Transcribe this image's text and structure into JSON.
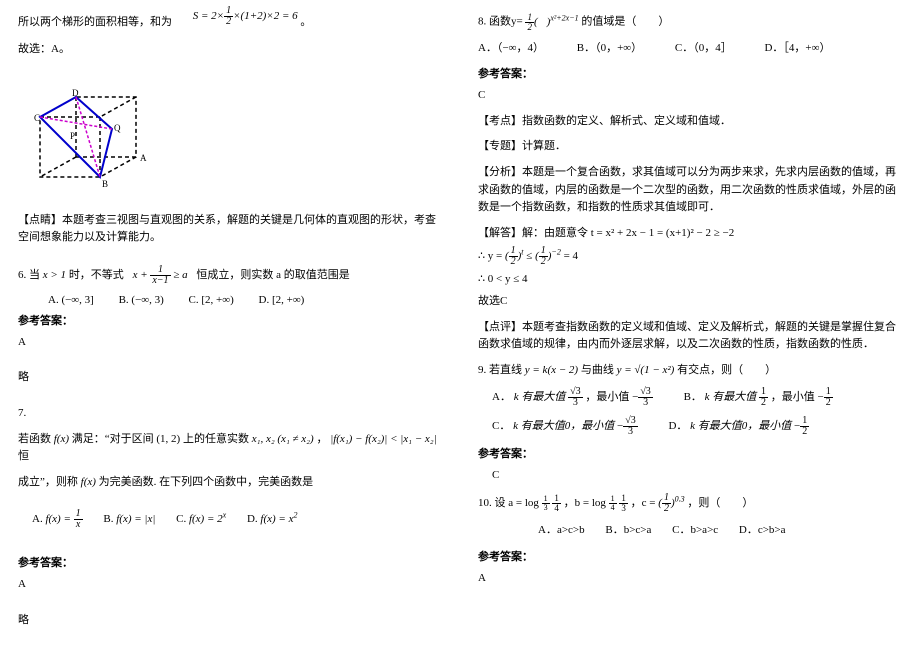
{
  "left": {
    "area_text": "所以两个梯形的面积相等，和为",
    "area_formula": "S = 2×(1/2)×(1+2)×2 = 6",
    "area_suffix": "。",
    "choice": "故选：A。",
    "dianjing": "【点睛】本题考查三视图与直观图的关系，解题的关键是几何体的直观图的形状，考查空间想象能力以及计算能力。",
    "q6_a": "6. 当",
    "q6_b": "x > 1",
    "q6_c": "时，不等式",
    "q6_formula": "x + 1/(x−1) ≥ a",
    "q6_d": "恒成立，则实数 a 的取值范围是",
    "q6_opts": {
      "a": "A. (−∞, 3]",
      "b": "B. (−∞, 3)",
      "c": "C. [2, +∞)",
      "d": "D. [2, +∞)"
    },
    "ans6_hdr": "参考答案：",
    "ans6": "A",
    "ans6_note": "略",
    "q7_num": "7.",
    "q7_a": "若函数",
    "q7_fx": "f(x)",
    "q7_b": "满足：“对于区间 (1, 2) 上的任意实数",
    "q7_c": "x₁, x₂ (x₁ ≠ x₂)，",
    "q7_d": "|f(x₁) − f(x₂)| < |x₁ − x₂|",
    "q7_e": " 恒",
    "q7_f": "成立”，则称",
    "q7_g": "为完美函数. 在下列四个函数中，完美函数是",
    "q7_opts": {
      "a_l": "A.",
      "a_f": "f(x) = 1/x",
      "b_l": "B.",
      "b_f": "f(x) = |x|",
      "c_l": "C.",
      "c_f": "f(x) = 2ˣ",
      "d_l": "D.",
      "d_f": "f(x) = x²"
    },
    "ans7_hdr": "参考答案：",
    "ans7": "A",
    "ans7_note": "略"
  },
  "right": {
    "q8_a": "8. 函数y=",
    "q8_base": "(1/2)",
    "q8_exp": "x²+2x−1",
    "q8_b": "的值域是（　　）",
    "q8_opts": {
      "a": "A．（−∞，4）",
      "b": "B．（0，+∞）",
      "c": "C．（0，4］",
      "d": "D．［4，+∞）"
    },
    "ans8_hdr": "参考答案：",
    "ans8": "C",
    "kaodian": "【考点】指数函数的定义、解析式、定义域和值域．",
    "zhuanti": "【专题】计算题．",
    "fenxi": "【分析】本题是一个复合函数，求其值域可以分为两步来求，先求内层函数的值域，再求函数的值域，内层的函数是一个二次型的函数，用二次函数的性质求值域，外层的函数是一个指数函数，和指数的性质求其值域即可．",
    "jieda_a": "【解答】解：由题意令 t = x² + 2x − 1 = (x+1)² − 2 ≥ −2",
    "jieda_b_pre": "∴ y =",
    "jieda_b_mid": " ≤ ",
    "jieda_b_exp2": "−2",
    "jieda_b_suf": " = 4",
    "jieda_c": "∴ 0 < y ≤ 4",
    "jieda_d": "故选C",
    "dianping": "【点评】本题考查指数函数的定义域和值域、定义及解析式，解题的关键是掌握住复合函数求值域的规律，由内而外逐层求解，以及二次函数的性质，指数函数的性质．",
    "q9_a": "9. 若直线",
    "q9_fy": "y = k(x − 2)",
    "q9_b": "与曲线",
    "q9_fc": "y = √(1 − x²)",
    "q9_c": "有交点，则（　　）",
    "q9_opts": {
      "a_l": "A．",
      "a_t": "k 有最大值",
      "a_v1": "√3/3",
      "a_m": "，最小值",
      "a_v2": "−√3/3",
      "b_l": "B．",
      "b_t": "k 有最大值",
      "b_v1": "1/2",
      "b_m": "，最小值",
      "b_v2": "−1/2",
      "c_l": "C．",
      "c_t": "k 有最大值0，最小值",
      "c_v": "−√3/3",
      "d_l": "D．",
      "d_t": "k 有最大值0，最小值",
      "d_v": "−1/2"
    },
    "ans9_hdr": "参考答案：",
    "ans9": "C",
    "q10_a": "10. 设 a = log",
    "q10_b": "，b = log",
    "q10_c": "，c =",
    "q10_base3": "(1/2)",
    "q10_exp3": "0.3",
    "q10_d": "，则（　　）",
    "q10_idx1": "1/3",
    "q10_val1": "1/4",
    "q10_idx2": "1/4",
    "q10_val2": "1/3",
    "q10_opts": {
      "a": "A．a>c>b",
      "b": "B．b>c>a",
      "c": "C．b>a>c",
      "d": "D．c>b>a"
    },
    "ans10_hdr": "参考答案：",
    "ans10": "A"
  }
}
